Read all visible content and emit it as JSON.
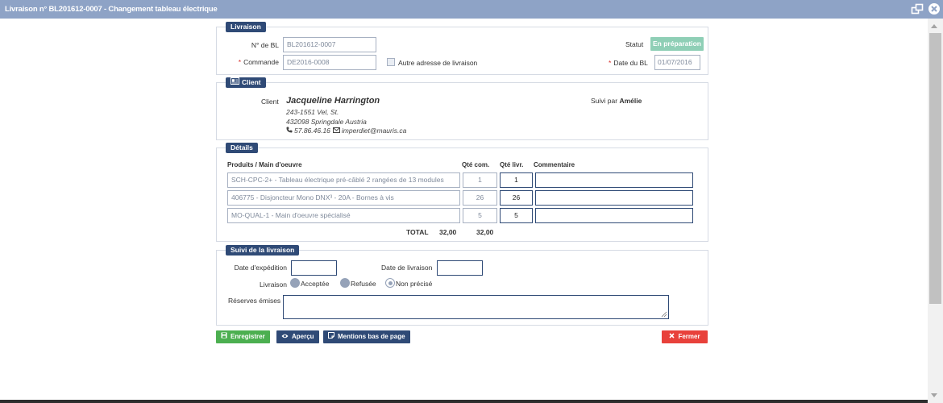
{
  "window": {
    "title": "Livraison n° BL201612-0007 - Changement tableau électrique"
  },
  "livraison": {
    "legend": "Livraison",
    "bl_label": "N° de BL",
    "bl_value": "BL201612-0007",
    "commande_label": "Commande",
    "commande_value": "DE2016-0008",
    "autre_adresse_label": "Autre adresse de livraison",
    "statut_label": "Statut",
    "statut_value": "En préparation",
    "date_bl_label": "Date du BL",
    "date_bl_value": "01/07/2016",
    "required_mark": "*"
  },
  "client": {
    "legend": "Client",
    "label": "Client",
    "name": "Jacqueline Harrington",
    "address_line1": "243-1551 Vel, St.",
    "address_line2": "432098  Springdale  Austria",
    "phone": "57.86.46.16",
    "email": "imperdiet@mauris.ca",
    "suivi_label": "Suivi par",
    "suivi_value": "Amélie"
  },
  "details": {
    "legend": "Détails",
    "headers": {
      "produits": "Produits / Main d'oeuvre",
      "qte_com": "Qté com.",
      "qte_livr": "Qté livr.",
      "commentaire": "Commentaire"
    },
    "rows": [
      {
        "produit": "SCH-CPC-2+ - Tableau électrique pré-câblé 2 rangées de 13 modules",
        "qte_com": "1",
        "qte_livr": "1",
        "commentaire": ""
      },
      {
        "produit": "406775 - Disjoncteur Mono DNX³ - 20A - Bornes à vis",
        "qte_com": "26",
        "qte_livr": "26",
        "commentaire": ""
      },
      {
        "produit": "MO-QUAL-1 - Main d'oeuvre spécialisé",
        "qte_com": "5",
        "qte_livr": "5",
        "commentaire": ""
      }
    ],
    "total_label": "TOTAL",
    "total_com": "32,00",
    "total_livr": "32,00"
  },
  "suivi": {
    "legend": "Suivi de la livraison",
    "date_expedition_label": "Date d'expédition",
    "date_expedition_value": "",
    "date_livraison_label": "Date de livraison",
    "date_livraison_value": "",
    "livraison_label": "Livraison",
    "options": [
      "Acceptée",
      "Refusée",
      "Non précisé"
    ],
    "selected_option": "Non précisé",
    "reserves_label": "Réserves émises",
    "reserves_value": ""
  },
  "actions": {
    "enregistrer": "Enregistrer",
    "apercu": "Aperçu",
    "mentions": "Mentions bas de page",
    "fermer": "Fermer"
  },
  "colors": {
    "titlebar": "#8ea3c6",
    "legend": "#2f4a76",
    "status_badge": "#8fcfb6",
    "save_button": "#4caf50",
    "close_button": "#e8413b",
    "required": "#d9302c"
  }
}
